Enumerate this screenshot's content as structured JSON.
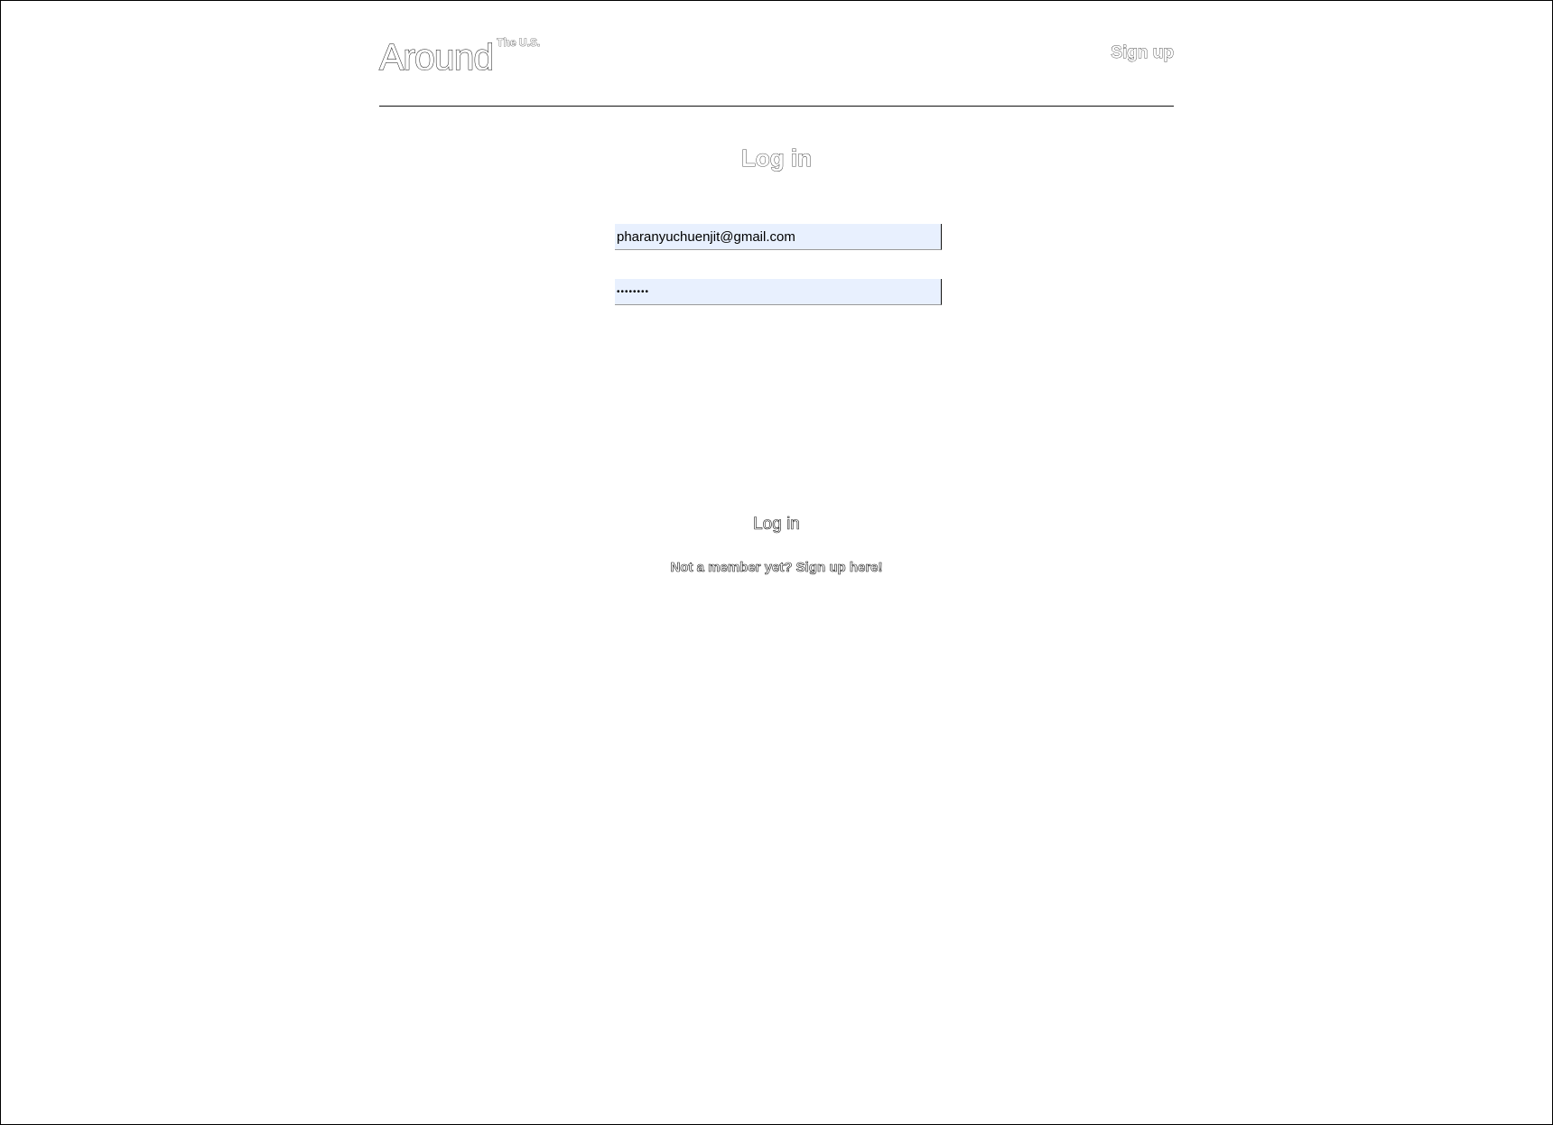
{
  "header": {
    "logo_text": "Around",
    "logo_superscript": "The U.S.",
    "signup_link": "Sign up"
  },
  "main": {
    "title": "Log in",
    "email_field": {
      "value": "pharanyuchuenjit@gmail.com",
      "placeholder": ""
    },
    "password_field": {
      "value": "••••••••",
      "placeholder": ""
    },
    "submit_label": "Log in",
    "signup_prompt": "Not a member yet? Sign up here!"
  },
  "colors": {
    "autofill_background": "#e8f0fe",
    "text": "#111111",
    "page_background": "#ffffff"
  }
}
